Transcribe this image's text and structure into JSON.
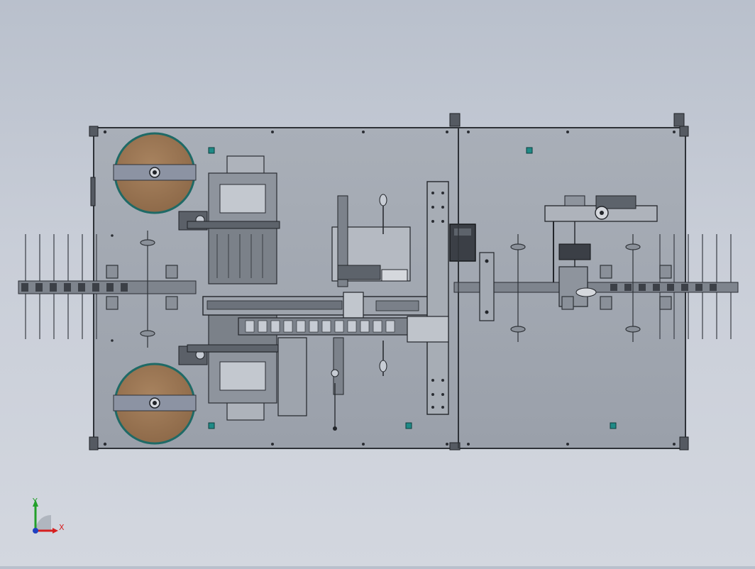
{
  "viewport": {
    "background_top": "#b9c0cc",
    "background_bottom": "#d3d7df"
  },
  "model": {
    "plate_color": "#a3a9b3",
    "plate_edge": "#3a3d44",
    "reel_fill": "#9b7656",
    "reel_rim": "#1f6a66",
    "accent_teal": "#1f8a86",
    "metal_light": "#c7ccd4",
    "metal_dark": "#3b3f46"
  },
  "triad": {
    "x_label": "X",
    "y_label": "Y",
    "x_color": "#d62020",
    "y_color": "#22a02a",
    "z_color": "#2040c0"
  }
}
